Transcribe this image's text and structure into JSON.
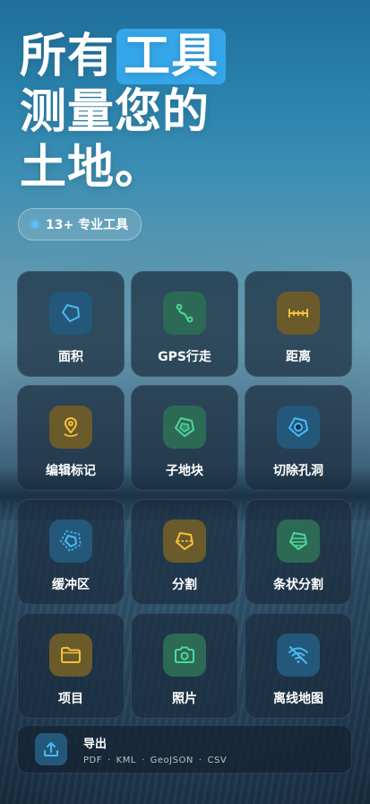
{
  "headline": {
    "line1_prefix": "所有",
    "line1_highlight": "工具",
    "line2": "测量您的",
    "line3": "土地。"
  },
  "badge": {
    "label": "13+ 专业工具"
  },
  "tools": [
    {
      "label": "面积",
      "icon": "polygon-icon",
      "tone": "blue"
    },
    {
      "label": "GPS行走",
      "icon": "route-icon",
      "tone": "green"
    },
    {
      "label": "距离",
      "icon": "ruler-icon",
      "tone": "amber"
    },
    {
      "label": "编辑标记",
      "icon": "map-pin-icon",
      "tone": "amber"
    },
    {
      "label": "子地块",
      "icon": "sub-plot-icon",
      "tone": "green"
    },
    {
      "label": "切除孔洞",
      "icon": "cut-hole-icon",
      "tone": "blue"
    },
    {
      "label": "缓冲区",
      "icon": "buffer-icon",
      "tone": "blue"
    },
    {
      "label": "分割",
      "icon": "split-icon",
      "tone": "amber"
    },
    {
      "label": "条状分割",
      "icon": "strip-split-icon",
      "tone": "green"
    },
    {
      "label": "项目",
      "icon": "folder-icon",
      "tone": "amber"
    },
    {
      "label": "照片",
      "icon": "camera-icon",
      "tone": "green"
    },
    {
      "label": "离线地图",
      "icon": "wifi-off-icon",
      "tone": "blue"
    }
  ],
  "export": {
    "title": "导出",
    "icon": "upload-icon",
    "formats": [
      "PDF",
      "KML",
      "GeoJSON",
      "CSV"
    ]
  },
  "colors": {
    "accent_blue": "#35a6e9",
    "icon_blue": "#4cb8f5",
    "icon_green": "#4fd69a",
    "icon_amber": "#f2c23a"
  }
}
